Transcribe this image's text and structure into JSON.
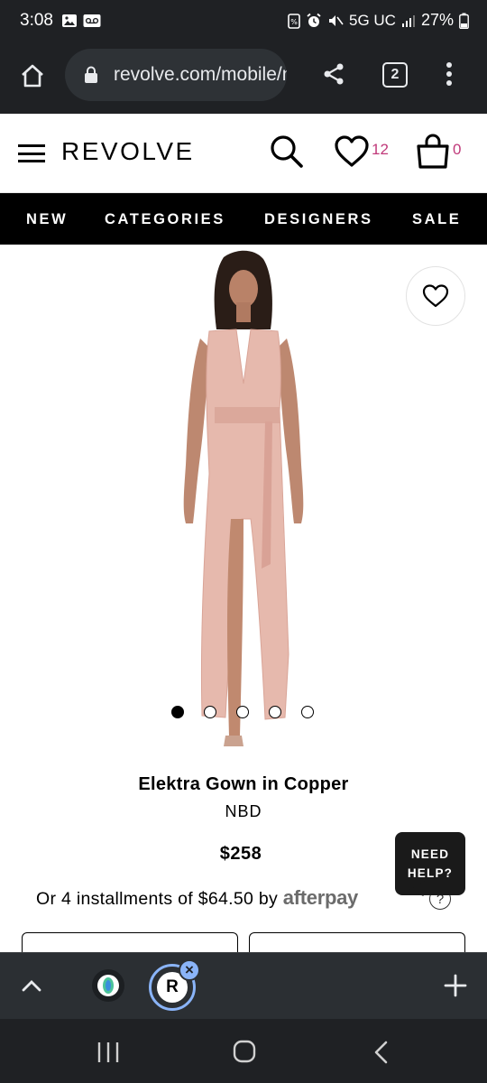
{
  "status_bar": {
    "time": "3:08",
    "network": "5G UC",
    "battery": "27%"
  },
  "browser": {
    "url": "revolve.com/mobile/nbd-elektra",
    "tab_count": "2"
  },
  "header": {
    "logo": "REVOLVE",
    "wishlist_count": "12",
    "bag_count": "0"
  },
  "nav": {
    "items": [
      "NEW",
      "CATEGORIES",
      "DESIGNERS",
      "SALE"
    ]
  },
  "product": {
    "name": "Elektra Gown in Copper",
    "brand": "NBD",
    "price": "$258",
    "installments_text": "Or 4 installments of $64.50 by",
    "afterpay_label": "afterpay",
    "info_label": "?",
    "image_count": 5,
    "active_image": 1
  },
  "help": {
    "line1": "NEED",
    "line2": "HELP?"
  },
  "toolbar": {
    "ext_letter": "R",
    "close_label": "×"
  },
  "colors": {
    "accent_pink": "#c0397a",
    "dark_chrome": "#1f2124",
    "dress": "#e6b9ad"
  }
}
